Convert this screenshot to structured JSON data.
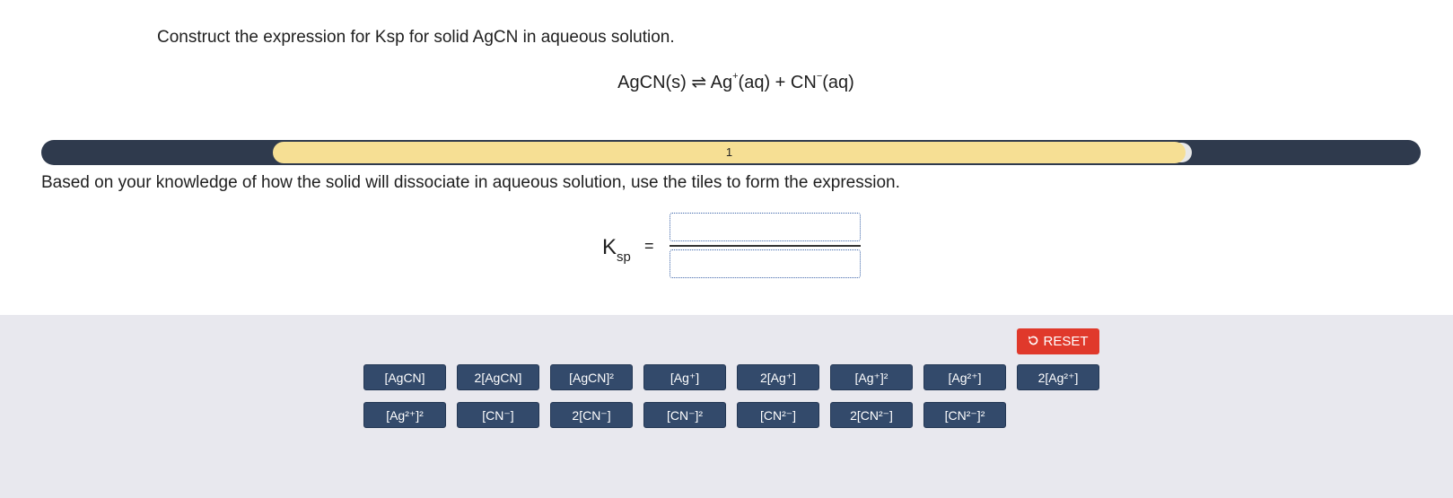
{
  "question": "Construct the expression for Ksp for solid AgCN in aqueous solution.",
  "equation": {
    "left": "AgCN(s)",
    "arrow": "⇌",
    "cation": "Ag",
    "cation_charge": "+",
    "cation_state": "(aq)",
    "plus": "+",
    "anion": "CN",
    "anion_charge": "−",
    "anion_state": "(aq)"
  },
  "progress": {
    "step_label": "1"
  },
  "instruction": "Based on your knowledge of how the solid will dissociate in aqueous solution, use the tiles to form the expression.",
  "expression": {
    "label_main": "K",
    "label_sub": "sp",
    "equals": "="
  },
  "reset": {
    "icon": "undo-icon",
    "label": "RESET"
  },
  "tiles_row1": [
    "[AgCN]",
    "2[AgCN]",
    "[AgCN]²",
    "[Ag⁺]",
    "2[Ag⁺]",
    "[Ag⁺]²",
    "[Ag²⁺]",
    "2[Ag²⁺]"
  ],
  "tiles_row2": [
    "[Ag²⁺]²",
    "[CN⁻]",
    "2[CN⁻]",
    "[CN⁻]²",
    "[CN²⁻]",
    "2[CN²⁻]",
    "[CN²⁻]²"
  ],
  "colors": {
    "track": "#2f3a4d",
    "segment": "#f6df94",
    "tile": "#334a6b",
    "reset": "#e0392b",
    "tile_area": "#e8e8ee"
  }
}
